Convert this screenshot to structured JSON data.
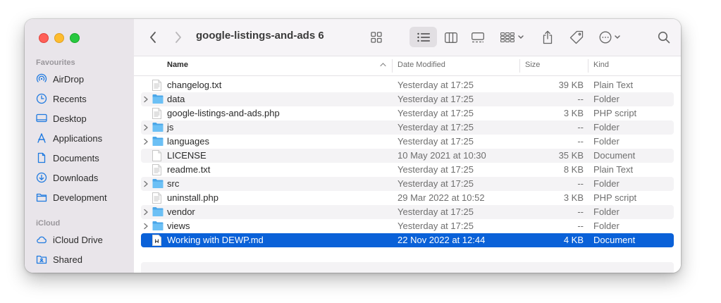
{
  "window": {
    "title": "google-listings-and-ads 6"
  },
  "sidebar": {
    "favourites_label": "Favourites",
    "favourites": [
      {
        "label": "AirDrop",
        "icon": "airdrop-icon"
      },
      {
        "label": "Recents",
        "icon": "clock-icon"
      },
      {
        "label": "Desktop",
        "icon": "desktop-icon"
      },
      {
        "label": "Applications",
        "icon": "applications-icon"
      },
      {
        "label": "Documents",
        "icon": "document-icon"
      },
      {
        "label": "Downloads",
        "icon": "download-icon"
      },
      {
        "label": "Development",
        "icon": "folder-icon"
      }
    ],
    "icloud_label": "iCloud",
    "icloud": [
      {
        "label": "iCloud Drive",
        "icon": "cloud-icon"
      },
      {
        "label": "Shared",
        "icon": "shared-folder-icon"
      }
    ]
  },
  "columns": {
    "name": "Name",
    "date": "Date Modified",
    "size": "Size",
    "kind": "Kind"
  },
  "files": [
    {
      "name": "changelog.txt",
      "date": "Yesterday at 17:25",
      "size": "39 KB",
      "kind": "Plain Text",
      "type": "text"
    },
    {
      "name": "data",
      "date": "Yesterday at 17:25",
      "size": "--",
      "kind": "Folder",
      "type": "folder"
    },
    {
      "name": "google-listings-and-ads.php",
      "date": "Yesterday at 17:25",
      "size": "3 KB",
      "kind": "PHP script",
      "type": "text"
    },
    {
      "name": "js",
      "date": "Yesterday at 17:25",
      "size": "--",
      "kind": "Folder",
      "type": "folder"
    },
    {
      "name": "languages",
      "date": "Yesterday at 17:25",
      "size": "--",
      "kind": "Folder",
      "type": "folder"
    },
    {
      "name": "LICENSE",
      "date": "10 May 2021 at 10:30",
      "size": "35 KB",
      "kind": "Document",
      "type": "blank"
    },
    {
      "name": "readme.txt",
      "date": "Yesterday at 17:25",
      "size": "8 KB",
      "kind": "Plain Text",
      "type": "text"
    },
    {
      "name": "src",
      "date": "Yesterday at 17:25",
      "size": "--",
      "kind": "Folder",
      "type": "folder"
    },
    {
      "name": "uninstall.php",
      "date": "29 Mar 2022 at 10:52",
      "size": "3 KB",
      "kind": "PHP script",
      "type": "text"
    },
    {
      "name": "vendor",
      "date": "Yesterday at 17:25",
      "size": "--",
      "kind": "Folder",
      "type": "folder"
    },
    {
      "name": "views",
      "date": "Yesterday at 17:25",
      "size": "--",
      "kind": "Folder",
      "type": "folder"
    },
    {
      "name": "Working with DEWP.md",
      "date": "22 Nov 2022 at 12:44",
      "size": "4 KB",
      "kind": "Document",
      "type": "markdown",
      "selected": true
    }
  ],
  "colors": {
    "accent": "#0a61d8",
    "sidebar_icon": "#1f7ae0",
    "folder": "#5bb3f0"
  }
}
